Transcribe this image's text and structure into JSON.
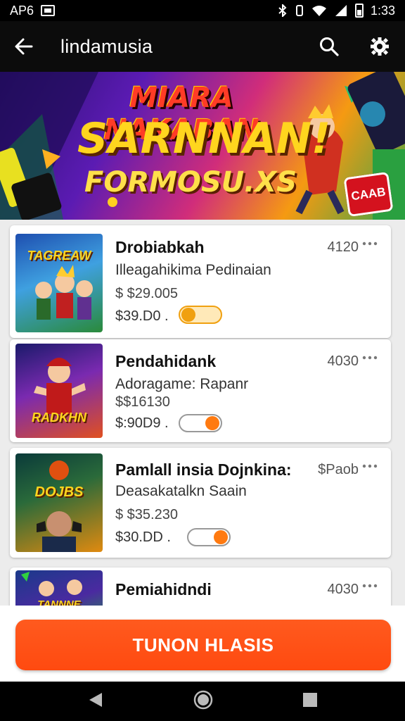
{
  "status_bar": {
    "left_text": "AP6",
    "time": "1:33"
  },
  "app_bar": {
    "title": "lindamusia"
  },
  "banner": {
    "line1": "MIARA NAKABAN",
    "line2": "SARNNAN!",
    "line3": "FORMOSU.XS",
    "badge": "CAAB"
  },
  "items": [
    {
      "title": "Drobiabkah",
      "meta": "4120",
      "subtitle": "Illeagahikima Pedinaian",
      "price1": "$ $29.005",
      "price2": "$39.D0 .",
      "thumb_label": "TAGREAW",
      "toggle": "on"
    },
    {
      "title": "Pendahidank",
      "meta": "4030",
      "subtitle": "Adoragame: Rapanr",
      "price1": "$$16130",
      "price2": "$:90D9 .",
      "thumb_label": "RADKHN",
      "toggle": "on"
    },
    {
      "title": "Pamlall insia Dojnkina:",
      "meta": "$Paob",
      "subtitle": "Deasakatalkn Saain",
      "price1": "$ $35.230",
      "price2": "$30.DD .",
      "thumb_label": "DOJBS",
      "toggle": "on"
    },
    {
      "title": "Pemiahidndi",
      "meta": "4030",
      "subtitle": "",
      "price1": "",
      "price2": "",
      "thumb_label": "TANNNE",
      "toggle": "off"
    }
  ],
  "cta": {
    "label": "TUNON HLASIS"
  },
  "colors": {
    "accent": "#ff5412",
    "toggle": "#f0a010",
    "app_bar": "#0c0c0c"
  },
  "icons": [
    "back-arrow-icon",
    "search-icon",
    "settings-icon",
    "more-vertical-icon",
    "nav-back-icon",
    "nav-home-icon",
    "nav-recents-icon"
  ]
}
